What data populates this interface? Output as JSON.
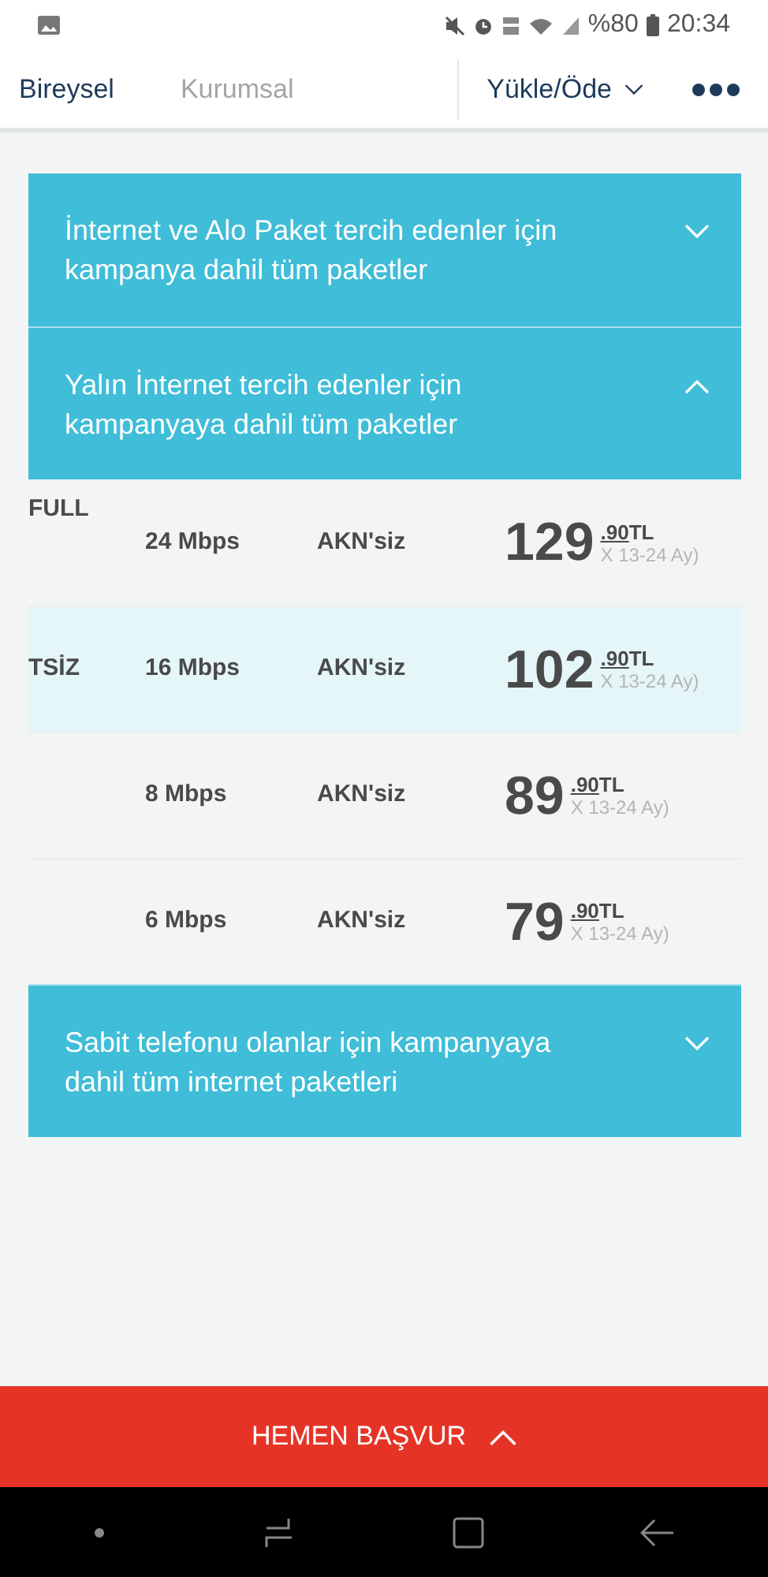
{
  "status_bar": {
    "battery": "%80",
    "time": "20:34"
  },
  "nav": {
    "tabs": [
      {
        "label": "Bireysel",
        "selected": true
      },
      {
        "label": "Kurumsal",
        "selected": false
      }
    ],
    "menu": "Yükle/Öde"
  },
  "sections": [
    {
      "title": "İnternet ve Alo Paket tercih edenler için kampanya dahil tüm paketler",
      "expanded": false
    },
    {
      "title": "Yalın İnternet tercih edenler için kampanyaya dahil tüm paketler",
      "expanded": true,
      "rows": [
        {
          "name": "FULL",
          "speed": "24 Mbps",
          "akn": "AKN'siz",
          "price": "129",
          "cents": ".90",
          "currency": "TL",
          "term": "X 13-24 Ay)",
          "highlighted": false
        },
        {
          "name": "TSİZ",
          "speed": "16 Mbps",
          "akn": "AKN'siz",
          "price": "102",
          "cents": ".90",
          "currency": "TL",
          "term": "X 13-24 Ay)",
          "highlighted": true
        },
        {
          "speed": "8 Mbps",
          "akn": "AKN'siz",
          "price": "89",
          "cents": ".90",
          "currency": "TL",
          "term": "X 13-24 Ay)",
          "highlighted": false
        },
        {
          "speed": "6 Mbps",
          "akn": "AKN'siz",
          "price": "79",
          "cents": ".90",
          "currency": "TL",
          "term": "X 13-24 Ay)",
          "highlighted": false
        }
      ]
    },
    {
      "title": "Sabit telefonu olanlar için kampanyaya dahil tüm internet paketleri",
      "expanded": false
    }
  ],
  "apply_button": "HEMEN BAŞVUR"
}
